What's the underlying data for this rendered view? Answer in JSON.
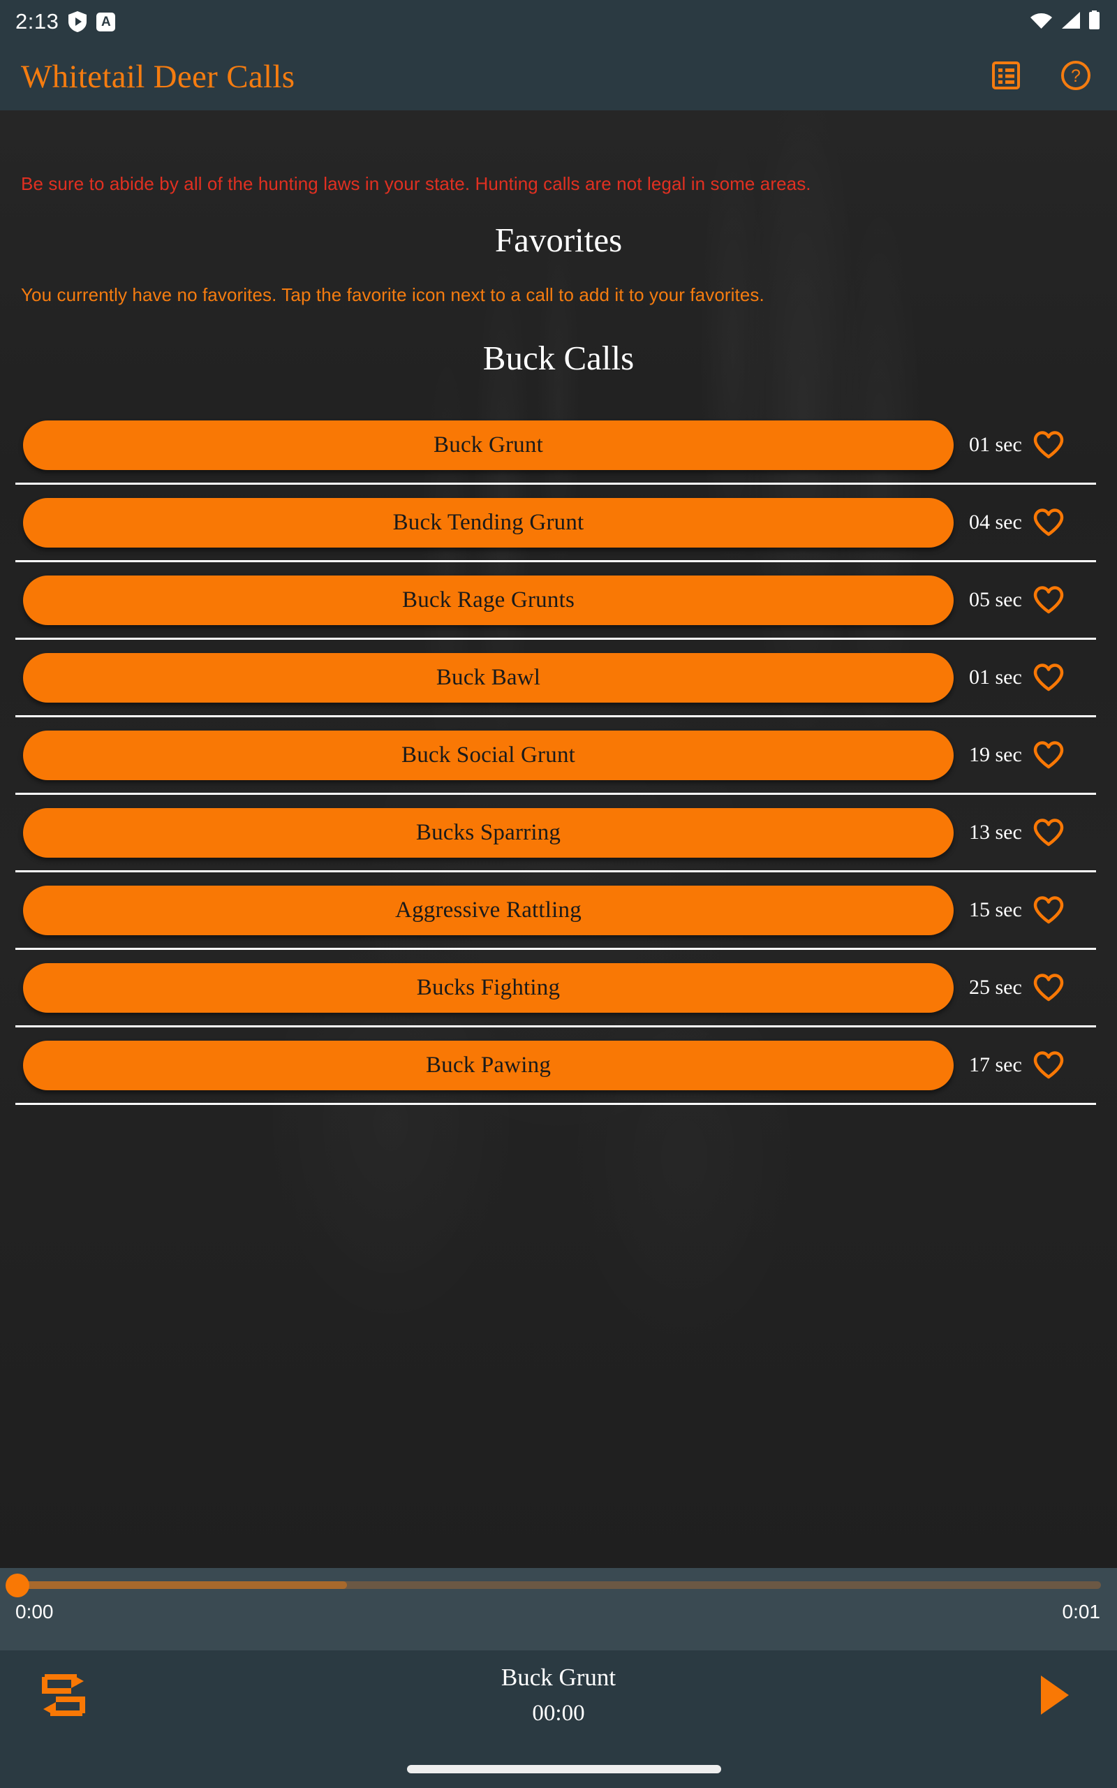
{
  "status_bar": {
    "time": "2:13",
    "left_icons": [
      "shield-play-icon",
      "assistant-a-icon"
    ],
    "assistant_label": "A",
    "right_icons": [
      "wifi-icon",
      "cellular-signal-icon",
      "battery-icon"
    ]
  },
  "app_bar": {
    "title": "Whitetail Deer Calls",
    "actions": [
      {
        "icon": "list-icon",
        "name": "list-view-button"
      },
      {
        "icon": "help-circle-icon",
        "name": "help-button"
      }
    ]
  },
  "content": {
    "disclaimer": "Be sure to abide by all of the hunting laws in your state. Hunting calls are not legal in some areas.",
    "favorites_title": "Favorites",
    "no_favorites_message": "You currently have no favorites. Tap the favorite icon next to a call to add it to your favorites.",
    "buck_calls_title": "Buck Calls",
    "calls": [
      {
        "name": "Buck Grunt",
        "duration": "01 sec",
        "favorited": false
      },
      {
        "name": "Buck Tending Grunt",
        "duration": "04 sec",
        "favorited": false
      },
      {
        "name": "Buck Rage Grunts",
        "duration": "05 sec",
        "favorited": false
      },
      {
        "name": "Buck Bawl",
        "duration": "01 sec",
        "favorited": false
      },
      {
        "name": "Buck Social Grunt",
        "duration": "19 sec",
        "favorited": false
      },
      {
        "name": "Bucks Sparring",
        "duration": "13 sec",
        "favorited": false
      },
      {
        "name": "Aggressive Rattling",
        "duration": "15 sec",
        "favorited": false
      },
      {
        "name": "Bucks Fighting",
        "duration": "25 sec",
        "favorited": false
      },
      {
        "name": "Buck Pawing",
        "duration": "17 sec",
        "favorited": false
      }
    ]
  },
  "seek": {
    "current_time": "0:00",
    "total_time": "0:01",
    "progress_percent": 31
  },
  "player": {
    "repeat_icon": "repeat-icon",
    "now_playing_title": "Buck Grunt",
    "now_playing_time": "00:00",
    "play_icon": "play-icon"
  },
  "colors": {
    "accent_orange": "#f97805",
    "app_bar_blue": "#2b3a42",
    "seek_panel_blue": "#3a4a52",
    "content_dark": "#222222",
    "warning_red": "#e03021",
    "white": "#ffffff"
  }
}
